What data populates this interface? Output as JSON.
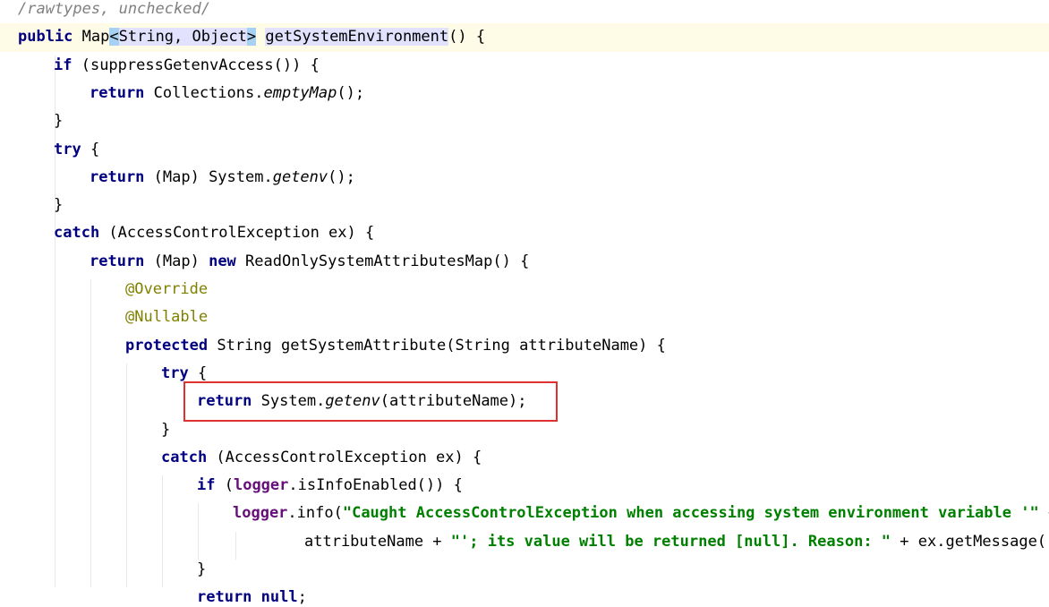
{
  "editor": {
    "lines": [
      [
        {
          "t": "/rawtypes, unchecked/",
          "c": "comment"
        }
      ],
      [
        {
          "t": "public",
          "c": "kw"
        },
        {
          "t": " Map"
        },
        {
          "t": "<",
          "c": "bracket-hl"
        },
        {
          "t": "String, Object",
          "c": "brace-hl"
        },
        {
          "t": ">",
          "c": "bracket-hl"
        },
        {
          "t": " "
        },
        {
          "t": "getSystemEnvironment",
          "c": "brace-hl"
        },
        {
          "t": "() {"
        }
      ],
      [
        {
          "t": "if",
          "c": "kw"
        },
        {
          "t": " (suppressGetenvAccess()) {"
        }
      ],
      [
        {
          "t": "return",
          "c": "kw"
        },
        {
          "t": " Collections."
        },
        {
          "t": "emptyMap",
          "c": "italic"
        },
        {
          "t": "();"
        }
      ],
      [
        {
          "t": "}"
        }
      ],
      [
        {
          "t": "try",
          "c": "kw"
        },
        {
          "t": " {"
        }
      ],
      [
        {
          "t": "return",
          "c": "kw"
        },
        {
          "t": " (Map) System."
        },
        {
          "t": "getenv",
          "c": "italic"
        },
        {
          "t": "();"
        }
      ],
      [
        {
          "t": "}"
        }
      ],
      [
        {
          "t": "catch",
          "c": "kw"
        },
        {
          "t": " (AccessControlException ex) {"
        }
      ],
      [
        {
          "t": "return",
          "c": "kw"
        },
        {
          "t": " (Map) "
        },
        {
          "t": "new",
          "c": "kw"
        },
        {
          "t": " ReadOnlySystemAttributesMap() {"
        }
      ],
      [
        {
          "t": "@Override",
          "c": "ann"
        }
      ],
      [
        {
          "t": "@Nullable",
          "c": "ann"
        }
      ],
      [
        {
          "t": "protected",
          "c": "kw"
        },
        {
          "t": " String getSystemAttribute(String attributeName) {"
        }
      ],
      [
        {
          "t": "try",
          "c": "kw"
        },
        {
          "t": " {"
        }
      ],
      [
        {
          "t": "return",
          "c": "kw"
        },
        {
          "t": " System."
        },
        {
          "t": "getenv",
          "c": "italic"
        },
        {
          "t": "(attributeName);"
        }
      ],
      [
        {
          "t": "}"
        }
      ],
      [
        {
          "t": "catch",
          "c": "kw"
        },
        {
          "t": " (AccessControlException ex) {"
        }
      ],
      [
        {
          "t": "if",
          "c": "kw"
        },
        {
          "t": " ("
        },
        {
          "t": "logger",
          "c": "field"
        },
        {
          "t": ".isInfoEnabled()) {"
        }
      ],
      [
        {
          "t": "logger",
          "c": "field"
        },
        {
          "t": ".info("
        },
        {
          "t": "\"Caught AccessControlException when accessing system environment variable '\"",
          "c": "str"
        },
        {
          "t": " +"
        }
      ],
      [
        {
          "t": "attributeName + "
        },
        {
          "t": "\"'; its value will be returned [null]. Reason: \"",
          "c": "str"
        },
        {
          "t": " + ex.getMessage())"
        }
      ],
      [
        {
          "t": "}"
        }
      ],
      [
        {
          "t": "return",
          "c": "kw"
        },
        {
          "t": " "
        },
        {
          "t": "null",
          "c": "kw"
        },
        {
          "t": ";"
        }
      ]
    ]
  },
  "colors": {
    "keyword": "#000080",
    "annotation": "#808000",
    "string": "#008000",
    "field": "#660e7a",
    "comment": "#808080",
    "highlight_box": "#e03030",
    "caret_line": "#fefbe6"
  }
}
